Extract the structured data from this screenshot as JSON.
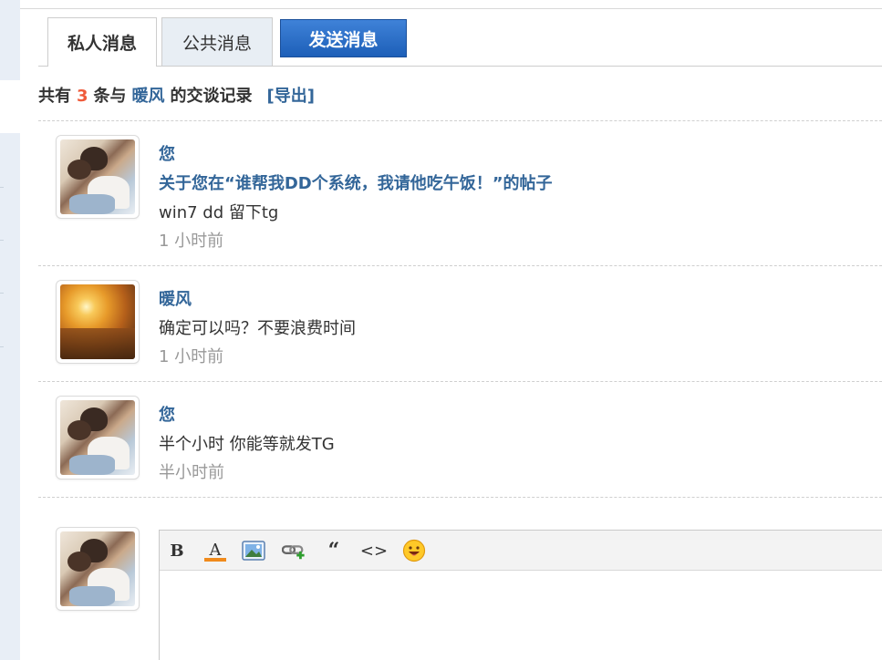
{
  "tabs": [
    {
      "label": "私人消息",
      "active": true
    },
    {
      "label": "公共消息",
      "active": false
    }
  ],
  "send_button": {
    "label": "发送消息"
  },
  "summary": {
    "prefix": "共有",
    "count": "3",
    "middle": "条与",
    "partner": "暖风",
    "suffix": "的交谈记录",
    "export_label": "[导出]"
  },
  "messages": [
    {
      "author": "您",
      "subject": "关于您在“谁帮我DD个系统，我请他吃午饭！”的帖子",
      "body": "win7 dd 留下tg",
      "time": "1 小时前",
      "avatar": "user-photo-couple"
    },
    {
      "author": "暖风",
      "subject": "",
      "body": "确定可以吗？不要浪费时间",
      "time": "1 小时前",
      "avatar": "user-photo-sunset"
    },
    {
      "author": "您",
      "subject": "",
      "body": "半个小时 你能等就发TG",
      "time": "半小时前",
      "avatar": "user-photo-couple"
    }
  ],
  "editor": {
    "toolbar": [
      {
        "icon": "bold-icon",
        "glyph": "B"
      },
      {
        "icon": "font-color-icon",
        "glyph": "A"
      },
      {
        "icon": "image-icon"
      },
      {
        "icon": "link-icon"
      },
      {
        "icon": "quote-icon",
        "glyph": "“"
      },
      {
        "icon": "code-icon",
        "glyph": "<>"
      },
      {
        "icon": "smiley-icon"
      }
    ],
    "value": ""
  },
  "colors": {
    "link": "#336699",
    "count": "#ef5b3b",
    "time": "#999999",
    "button": "#2563b8"
  }
}
